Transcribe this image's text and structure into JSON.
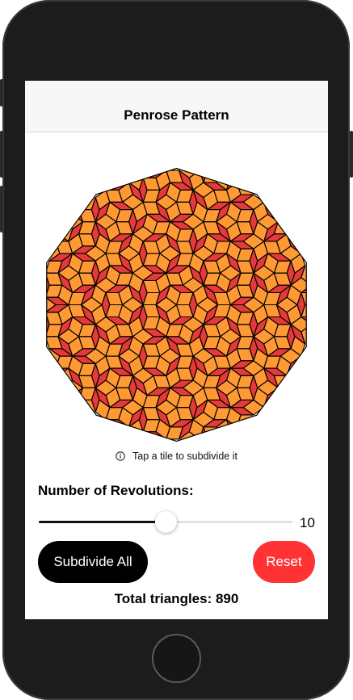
{
  "nav": {
    "title": "Penrose Pattern"
  },
  "pattern": {
    "tile_colors": {
      "thick": "#ff9933",
      "thin": "#e63939",
      "edge": "#000000"
    }
  },
  "hint": {
    "icon": "info-circle-icon",
    "text": "Tap a tile to subdivide it"
  },
  "revolutions": {
    "label": "Number of Revolutions:",
    "value": "10",
    "fraction": 0.5
  },
  "buttons": {
    "subdivide": "Subdivide All",
    "reset": "Reset"
  },
  "stats": {
    "total": "Total triangles: 890"
  },
  "colors": {
    "accent_red": "#ff3333",
    "button_black": "#000000"
  }
}
